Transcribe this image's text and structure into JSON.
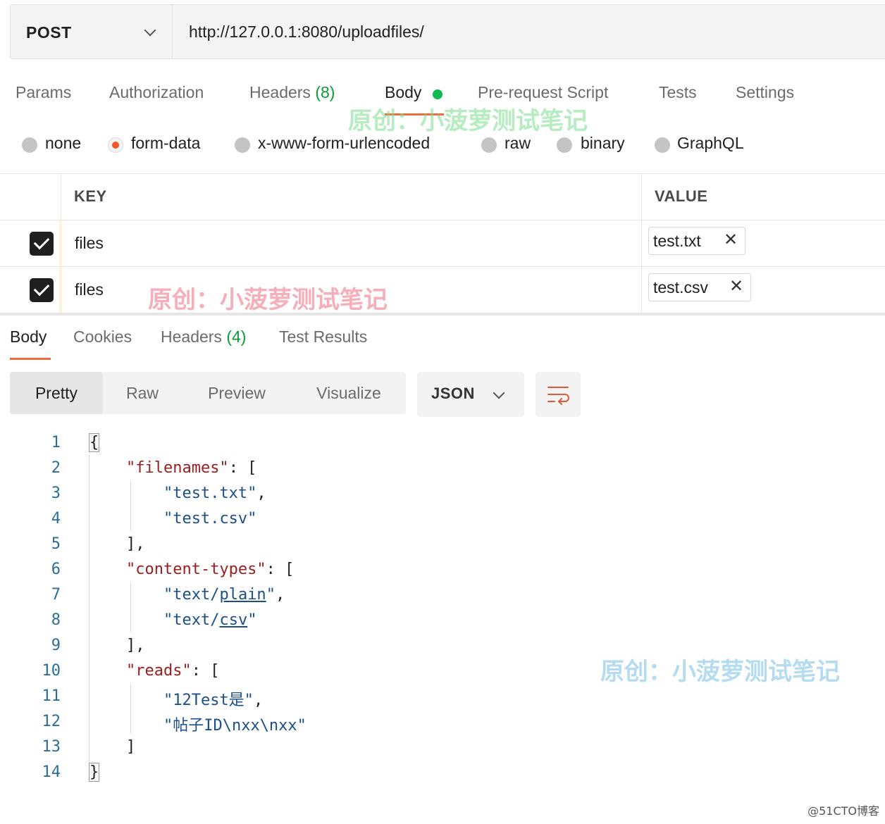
{
  "request": {
    "method": "POST",
    "url": "http://127.0.0.1:8080/uploadfiles/"
  },
  "request_tabs": [
    {
      "label": "Params"
    },
    {
      "label": "Authorization"
    },
    {
      "label": "Headers",
      "count": "(8)"
    },
    {
      "label": "Body",
      "active": true
    },
    {
      "label": "Pre-request Script"
    },
    {
      "label": "Tests"
    },
    {
      "label": "Settings"
    }
  ],
  "body_types": [
    {
      "label": "none",
      "selected": false
    },
    {
      "label": "form-data",
      "selected": true
    },
    {
      "label": "x-www-form-urlencoded",
      "selected": false
    },
    {
      "label": "raw",
      "selected": false
    },
    {
      "label": "binary",
      "selected": false
    },
    {
      "label": "GraphQL",
      "selected": false
    }
  ],
  "form_table": {
    "headers": [
      "KEY",
      "VALUE"
    ],
    "rows": [
      {
        "checked": true,
        "key": "files",
        "value": "test.txt"
      },
      {
        "checked": true,
        "key": "files",
        "value": "test.csv"
      }
    ]
  },
  "response_tabs": [
    {
      "label": "Body",
      "active": true
    },
    {
      "label": "Cookies"
    },
    {
      "label": "Headers",
      "count": "(4)"
    },
    {
      "label": "Test Results"
    }
  ],
  "view_modes": [
    "Pretty",
    "Raw",
    "Preview",
    "Visualize"
  ],
  "active_view": "Pretty",
  "language": "JSON",
  "code_lines": [
    {
      "n": "1",
      "text": "{"
    },
    {
      "n": "2",
      "text": "    \"filenames\": ["
    },
    {
      "n": "3",
      "text": "        \"test.txt\","
    },
    {
      "n": "4",
      "text": "        \"test.csv\""
    },
    {
      "n": "5",
      "text": "    ],"
    },
    {
      "n": "6",
      "text": "    \"content-types\": ["
    },
    {
      "n": "7",
      "text": "        \"text/plain\","
    },
    {
      "n": "8",
      "text": "        \"text/csv\""
    },
    {
      "n": "9",
      "text": "    ],"
    },
    {
      "n": "10",
      "text": "    \"reads\": ["
    },
    {
      "n": "11",
      "text": "        \"12Test是\","
    },
    {
      "n": "12",
      "text": "        \"帖子ID\\nxx\\nxx\""
    },
    {
      "n": "13",
      "text": "    ]"
    },
    {
      "n": "14",
      "text": "}"
    }
  ],
  "json_parts": {
    "k_filenames": "\"filenames\"",
    "s_test_txt": "\"test.txt\"",
    "s_test_csv": "\"test.csv\"",
    "k_content_types": "\"content-types\"",
    "s_text_open": "\"text/",
    "s_plain": "plain",
    "s_csv": "csv",
    "s_quote": "\"",
    "k_reads": "\"reads\"",
    "s_read_1": "\"12Test是\"",
    "s_read_2": "\"帖子ID\\nxx\\nxx\""
  },
  "watermarks": {
    "top": "原创：小菠萝测试笔记",
    "middle": "原创：小菠萝测试笔记",
    "right": "原创：小菠萝测试笔记",
    "corner": "@51CTO博客"
  },
  "colors": {
    "accent": "#f26b3a",
    "body_dot": "#0cbb52",
    "count_green": "#0a9d38",
    "json_key": "#9b1d1d",
    "json_string": "#1b4f8a"
  }
}
